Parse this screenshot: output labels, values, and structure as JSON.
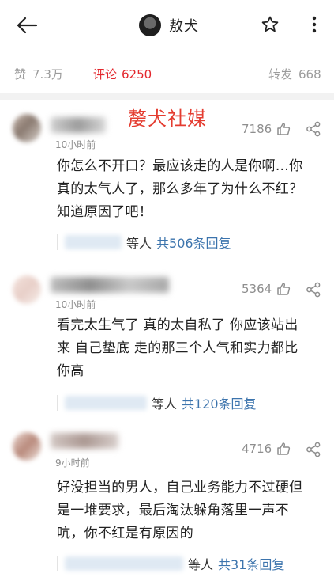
{
  "header": {
    "title": "敖犬",
    "back_icon": "back-arrow-icon",
    "star_icon": "star-icon",
    "more_icon": "more-vertical-icon"
  },
  "stats": {
    "like_label": "赞",
    "like_count": "7.3万",
    "comment_label": "评论",
    "comment_count": "6250",
    "share_label": "转发",
    "share_count": "668",
    "active_color": "#e3262c"
  },
  "watermark": "嫠犬社媒",
  "comments": [
    {
      "time": "10小时前",
      "likes": "7186",
      "text": [
        "你怎么不开口？最应该走的人是你啊…你",
        "真的太气人了，那么多年了为什么不红？",
        "知道原因了吧！"
      ],
      "reply_who": "等人",
      "reply_count": "共506条回复"
    },
    {
      "time": "10小时前",
      "likes": "5364",
      "text": [
        "看完太生气了 真的太自私了 你应该站出",
        "来 自己垫底 走的那三个人气和实力都比",
        "你高"
      ],
      "reply_who": "等人",
      "reply_count": "共120条回复"
    },
    {
      "time": "9小时前",
      "likes": "4716",
      "text": [
        "好没担当的男人，自己业务能力不过硬但",
        "是一堆要求，最后淘汰躲角落里一声不",
        "吭，你不红是有原因的"
      ],
      "reply_who": "等人",
      "reply_count": "共31条回复"
    }
  ],
  "colors": {
    "link": "#3c74ad",
    "muted": "#8e8e8e",
    "watermark": "#e43c30"
  }
}
